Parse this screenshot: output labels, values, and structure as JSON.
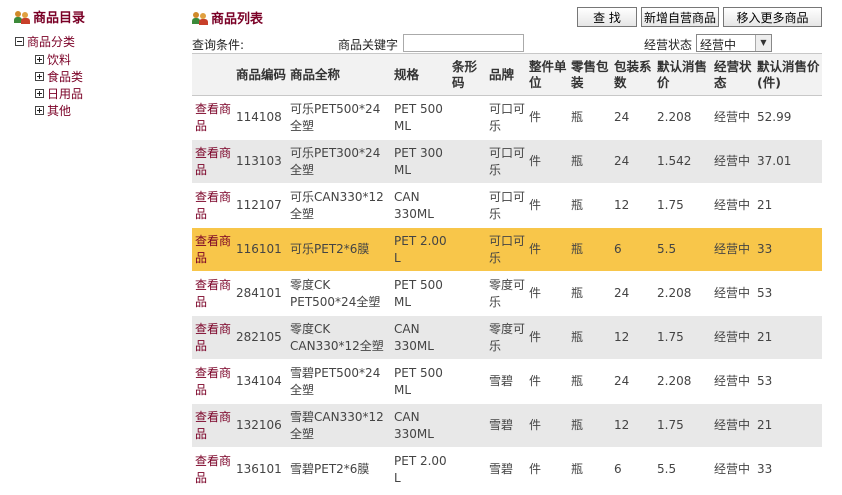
{
  "sidebar": {
    "title": "商品目录",
    "root": "商品分类",
    "children": [
      "饮料",
      "食品类",
      "日用品",
      "其他"
    ]
  },
  "main": {
    "title": "商品列表",
    "buttons": {
      "search": "查 找",
      "add": "新增自营商品",
      "import": "移入更多商品"
    },
    "filter": {
      "query_label": "查询条件:",
      "keyword_label": "商品关键字",
      "keyword_value": "",
      "status_label": "经营状态",
      "status_value": "经营中"
    },
    "columns": [
      "",
      "商品编码",
      "商品全称",
      "规格",
      "条形码",
      "品牌",
      "整件单位",
      "零售包装",
      "包装系数",
      "默认消售价",
      "经营状态",
      "默认消售价(件)"
    ],
    "rows": [
      {
        "view": "查看商品",
        "code": "114108",
        "name": "可乐PET500*24全塑",
        "spec": "PET 500 ML",
        "barcode": "",
        "brand": "可口可乐",
        "unit": "件",
        "pack": "瓶",
        "factor": "24",
        "price": "2.208",
        "status": "经营中",
        "case_price": "52.99"
      },
      {
        "view": "查看商品",
        "code": "113103",
        "name": "可乐PET300*24全塑",
        "spec": "PET 300 ML",
        "barcode": "",
        "brand": "可口可乐",
        "unit": "件",
        "pack": "瓶",
        "factor": "24",
        "price": "1.542",
        "status": "经营中",
        "case_price": "37.01"
      },
      {
        "view": "查看商品",
        "code": "112107",
        "name": "可乐CAN330*12全塑",
        "spec": "CAN 330ML",
        "barcode": "",
        "brand": "可口可乐",
        "unit": "件",
        "pack": "瓶",
        "factor": "12",
        "price": "1.75",
        "status": "经营中",
        "case_price": "21"
      },
      {
        "view": "查看商品",
        "code": "116101",
        "name": "可乐PET2*6膜",
        "spec": "PET 2.00 L",
        "barcode": "",
        "brand": "可口可乐",
        "unit": "件",
        "pack": "瓶",
        "factor": "6",
        "price": "5.5",
        "status": "经营中",
        "case_price": "33"
      },
      {
        "view": "查看商品",
        "code": "284101",
        "name": "零度CK PET500*24全塑",
        "spec": "PET 500 ML",
        "barcode": "",
        "brand": "零度可乐",
        "unit": "件",
        "pack": "瓶",
        "factor": "24",
        "price": "2.208",
        "status": "经营中",
        "case_price": "53"
      },
      {
        "view": "查看商品",
        "code": "282105",
        "name": "零度CK CAN330*12全塑",
        "spec": "CAN 330ML",
        "barcode": "",
        "brand": "零度可乐",
        "unit": "件",
        "pack": "瓶",
        "factor": "12",
        "price": "1.75",
        "status": "经营中",
        "case_price": "21"
      },
      {
        "view": "查看商品",
        "code": "134104",
        "name": "雪碧PET500*24全塑",
        "spec": "PET 500 ML",
        "barcode": "",
        "brand": "雪碧",
        "unit": "件",
        "pack": "瓶",
        "factor": "24",
        "price": "2.208",
        "status": "经营中",
        "case_price": "53"
      },
      {
        "view": "查看商品",
        "code": "132106",
        "name": "雪碧CAN330*12全塑",
        "spec": "CAN 330ML",
        "barcode": "",
        "brand": "雪碧",
        "unit": "件",
        "pack": "瓶",
        "factor": "12",
        "price": "1.75",
        "status": "经营中",
        "case_price": "21"
      },
      {
        "view": "查看商品",
        "code": "136101",
        "name": "雪碧PET2*6膜",
        "spec": "PET 2.00 L",
        "barcode": "",
        "brand": "雪碧",
        "unit": "件",
        "pack": "瓶",
        "factor": "6",
        "price": "5.5",
        "status": "经营中",
        "case_price": "33"
      }
    ]
  },
  "colors": {
    "accent": "#7a0026",
    "row_alt": "#e8e8e8",
    "row_selected": "#f8c64a"
  },
  "icons": {
    "header": "users-icon",
    "expand": "minus-box-icon",
    "collapse": "plus-box-icon"
  }
}
